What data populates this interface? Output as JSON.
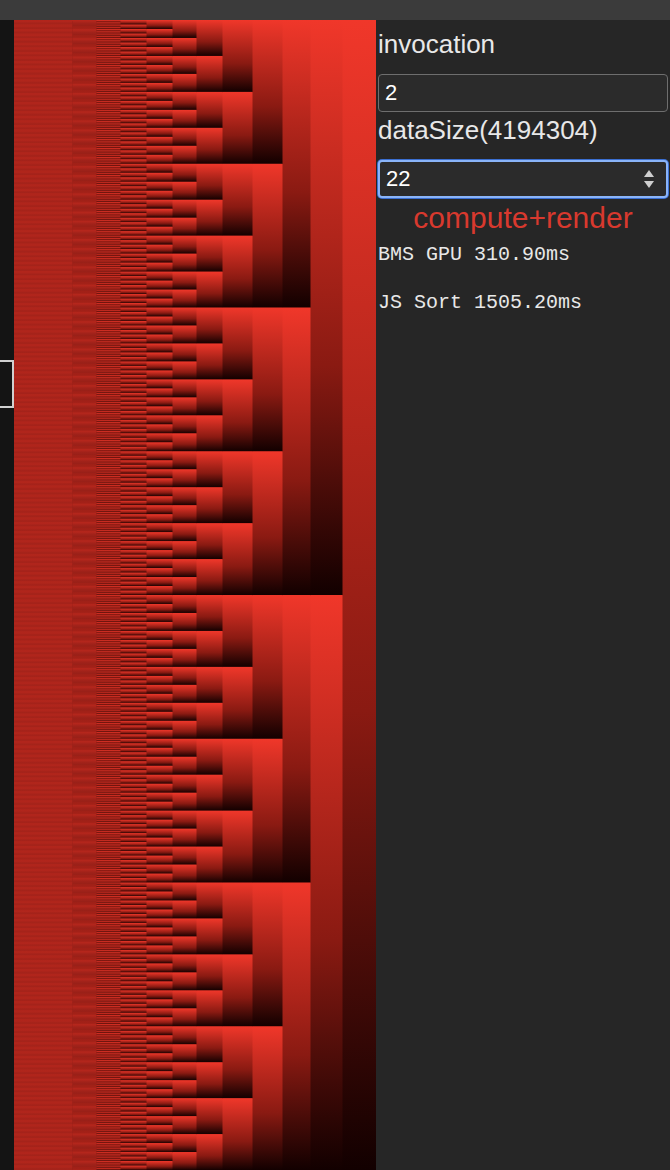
{
  "controls": {
    "fields": [
      {
        "label": "invocation",
        "value": "2",
        "kind": "text",
        "focused": false
      },
      {
        "label": "dataSize(4194304)",
        "value": "22",
        "kind": "number",
        "focused": true
      }
    ],
    "status": "compute+render",
    "timings": [
      "BMS GPU 310.90ms",
      "JS Sort 1505.20ms"
    ]
  }
}
